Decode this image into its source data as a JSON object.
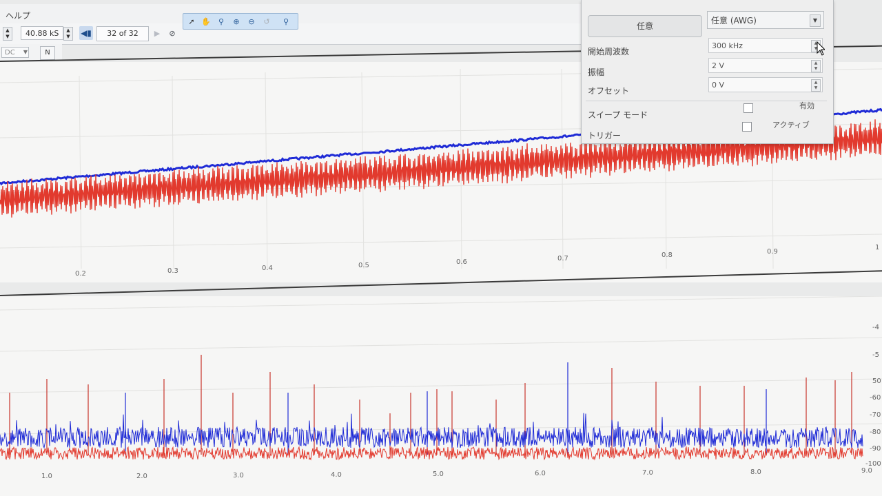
{
  "menu": {
    "help": "ヘルプ"
  },
  "toolbar": {
    "samples_value": "40.88 kS",
    "buffer_position": "32 of 32",
    "coupling_value": "DC",
    "icons": [
      "spin-icon",
      "rewind-icon",
      "play-next-icon",
      "compass-icon",
      "pointer-icon",
      "hand-icon",
      "zoom-in-icon",
      "zoom-plus-icon",
      "zoom-minus-icon",
      "undo-zoom-icon",
      "zoom-fit-icon",
      "probe-icon"
    ]
  },
  "awg": {
    "button_label": "任意",
    "waveform_select": "任意 (AWG)",
    "start_freq_label": "開始周波数",
    "start_freq_value": "300 kHz",
    "amplitude_label": "振幅",
    "amplitude_value": "2 V",
    "offset_label": "オフセット",
    "offset_value": "0 V",
    "sweep_label": "スイープ モード",
    "sweep_enabled_label": "有効",
    "trigger_label": "トリガー",
    "trigger_active_label": "アクティブ"
  },
  "top_plot": {
    "x_ticks": [
      "0.2",
      "0.3",
      "0.4",
      "0.5",
      "0.6",
      "0.7",
      "0.8",
      "0.9",
      "1"
    ],
    "series_colors": {
      "channel_a": "#1f2bd6",
      "channel_b": "#e23a2e"
    }
  },
  "bottom_plot": {
    "x_ticks": [
      "1.0",
      "2.0",
      "3.0",
      "4.0",
      "5.0",
      "6.0",
      "7.0",
      "8.0",
      "9.0"
    ],
    "y_ticks": [
      "-4",
      "-5",
      "50",
      "-60",
      "-70",
      "-80",
      "-90",
      "-100"
    ]
  }
}
